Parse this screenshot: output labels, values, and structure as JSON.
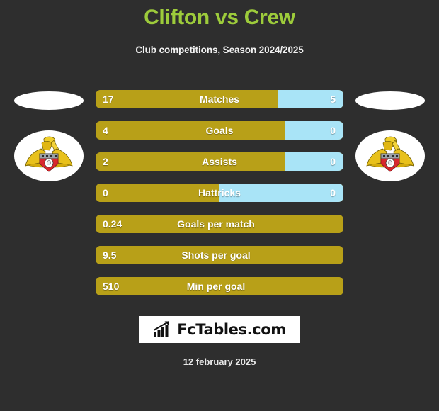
{
  "header": {
    "title": "Clifton vs Crew",
    "subtitle": "Club competitions, Season 2024/2025",
    "title_color": "#9dcb3b"
  },
  "theme": {
    "background": "#2e2e2e",
    "home_color": "#b8a018",
    "away_color": "#a9e4f7",
    "text_color": "#ffffff"
  },
  "badges": {
    "left_crest_name": "doncaster-rovers-crest",
    "right_crest_name": "doncaster-rovers-crest"
  },
  "footer": {
    "logo_text": "FcTables.com",
    "logo_icon": "bar-chart-arrow-icon",
    "date": "12 february 2025"
  },
  "chart_data": {
    "type": "bar",
    "title": "Clifton vs Crew",
    "subtitle": "Club competitions, Season 2024/2025",
    "orientation": "horizontal-diverging",
    "legend": [
      "Clifton",
      "Crew"
    ],
    "legend_position": "none",
    "grid": false,
    "categories": [
      "Matches",
      "Goals",
      "Assists",
      "Hattricks",
      "Goals per match",
      "Shots per goal",
      "Min per goal"
    ],
    "series": [
      {
        "name": "Clifton",
        "color": "#b8a018",
        "values": [
          17,
          4,
          2,
          0,
          0.24,
          9.5,
          510
        ],
        "display": [
          "17",
          "4",
          "2",
          "0",
          "0.24",
          "9.5",
          "510"
        ]
      },
      {
        "name": "Crew",
        "color": "#a9e4f7",
        "values": [
          5,
          0,
          0,
          0,
          null,
          null,
          null
        ],
        "display": [
          "5",
          "0",
          "0",
          "0",
          "",
          "",
          ""
        ]
      }
    ],
    "rows": [
      {
        "label": "Matches",
        "home": "17",
        "away": "5",
        "home_pct": 73.7,
        "has_away": true
      },
      {
        "label": "Goals",
        "home": "4",
        "away": "0",
        "home_pct": 76.3,
        "has_away": true
      },
      {
        "label": "Assists",
        "home": "2",
        "away": "0",
        "home_pct": 76.3,
        "has_away": true
      },
      {
        "label": "Hattricks",
        "home": "0",
        "away": "0",
        "home_pct": 50.0,
        "has_away": true
      },
      {
        "label": "Goals per match",
        "home": "0.24",
        "away": "",
        "home_pct": 100,
        "has_away": false
      },
      {
        "label": "Shots per goal",
        "home": "9.5",
        "away": "",
        "home_pct": 100,
        "has_away": false
      },
      {
        "label": "Min per goal",
        "home": "510",
        "away": "",
        "home_pct": 100,
        "has_away": false
      }
    ]
  }
}
